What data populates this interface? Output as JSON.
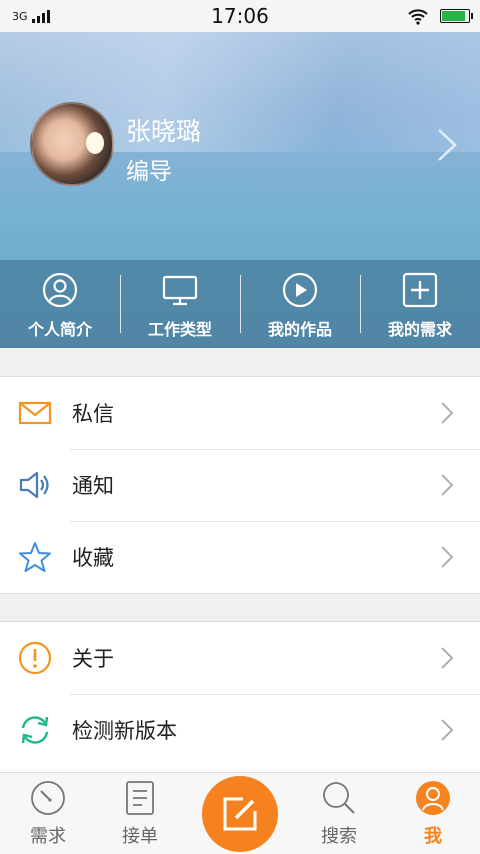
{
  "status_bar": {
    "network": "3G",
    "time": "17:06",
    "battery_level": 0.9
  },
  "profile": {
    "name": "张晓璐",
    "role": "编导"
  },
  "quick_actions": [
    {
      "label": "个人简介",
      "icon": "person-circle-icon"
    },
    {
      "label": "工作类型",
      "icon": "monitor-icon"
    },
    {
      "label": "我的作品",
      "icon": "play-circle-icon"
    },
    {
      "label": "我的需求",
      "icon": "plus-square-icon"
    }
  ],
  "menu_group_1": [
    {
      "label": "私信",
      "icon": "mail-icon",
      "color": "#f5931f"
    },
    {
      "label": "通知",
      "icon": "speaker-icon",
      "color": "#4a7bb5"
    },
    {
      "label": "收藏",
      "icon": "star-icon",
      "color": "#3e8fd8"
    }
  ],
  "menu_group_2": [
    {
      "label": "关于",
      "icon": "info-icon",
      "color": "#f5931f"
    },
    {
      "label": "检测新版本",
      "icon": "refresh-icon",
      "color": "#1db78b"
    }
  ],
  "tab_bar": {
    "tabs": [
      {
        "label": "需求",
        "icon": "compass-icon",
        "active": false
      },
      {
        "label": "接单",
        "icon": "document-icon",
        "active": false
      },
      {
        "label": "搜索",
        "icon": "search-icon",
        "active": false
      },
      {
        "label": "我",
        "icon": "user-icon",
        "active": true
      }
    ],
    "center_action": {
      "icon": "edit-icon",
      "color": "#f5821f"
    }
  },
  "colors": {
    "accent": "#f5821f",
    "header_bar": "#4e8aa8",
    "battery": "#2bb34a"
  }
}
